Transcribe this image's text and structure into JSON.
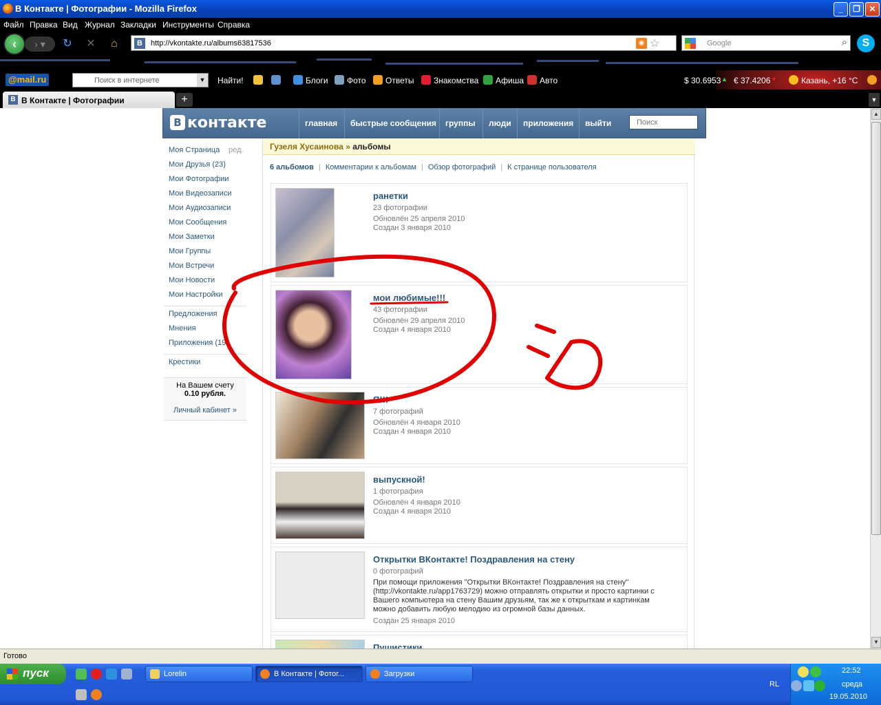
{
  "window": {
    "title": "В Контакте | Фотографии - Mozilla Firefox"
  },
  "menubar": [
    "Файл",
    "Правка",
    "Вид",
    "Журнал",
    "Закладки",
    "Инструменты",
    "Справка"
  ],
  "navbar": {
    "url": "http://vkontakte.ru/albums63817536",
    "search_placeholder": "Google"
  },
  "mailbar": {
    "logo": "@mail.ru",
    "search_placeholder": "Поиск в интернете",
    "find": "Найти!",
    "links": [
      "Блоги",
      "Фото",
      "Ответы",
      "Знакомства",
      "Афиша",
      "Авто"
    ],
    "usd": "$ 30.6953",
    "eur": "€ 37.4206",
    "weather": "Казань, +16 °C"
  },
  "tabs": [
    {
      "label": "В Контакте | Фотографии"
    }
  ],
  "vk": {
    "logo": "контакте",
    "logo_letter": "В",
    "nav": [
      "главная",
      "быстрые сообщения",
      "группы",
      "люди",
      "приложения",
      "выйти"
    ],
    "search_placeholder": "Поиск",
    "left_menu": [
      "Моя Страница",
      "Мои Друзья (23)",
      "Мои Фотографии",
      "Мои Видеозаписи",
      "Мои Аудиозаписи",
      "Мои Сообщения",
      "Мои Заметки",
      "Мои Группы",
      "Мои Встречи",
      "Мои Новости",
      "Мои Настройки",
      "Предложения",
      "Мнения",
      "Приложения (19",
      "Крестики"
    ],
    "edit_label": "ред.",
    "balance": {
      "line1": "На Вашем счету",
      "amount": "0.10 рубля.",
      "link": "Личный кабинет »"
    },
    "breadcrumb": {
      "user": "Гузеля Хусаинова",
      "sep": " » ",
      "page": "альбомы"
    },
    "subtabs": [
      "6 альбомов",
      "Комментарии к альбомам",
      "Обзор фотографий",
      "К странице пользователя"
    ],
    "albums": [
      {
        "name": "ранетки",
        "count": "23 фотографии",
        "updated": "Обновлён 25 апреля 2010",
        "created": "Создан 3 января 2010"
      },
      {
        "name": "мои любимые!!!",
        "count": "43 фотографии",
        "updated": "Обновлён 29 апреля 2010",
        "created": "Создан 4 января 2010"
      },
      {
        "name": "Я!!!",
        "count": "7 фотографий",
        "updated": "Обновлён 4 января 2010",
        "created": "Создан 4 января 2010"
      },
      {
        "name": "выпускной!",
        "count": "1 фотография",
        "updated": "Обновлён 4 января 2010",
        "created": "Создан 4 января 2010"
      },
      {
        "name": "Открытки ВКонтакте! Поздравления на стену",
        "count": "0 фотографий",
        "description": "При помощи приложения \"Открытки ВКонтакте! Поздравления на стену\" (http://vkontakte.ru/app1763729) можно отправлять открытки и просто картинки с Вашего компьютера на стену Вашим друзьям, так же к открыткам и картинкам можно добавить любую мелодию из огромной базы данных.",
        "created": "Создан 25 января 2010"
      },
      {
        "name": "Пушистики"
      }
    ]
  },
  "statusbar": {
    "text": "Готово"
  },
  "taskbar": {
    "start": "пуск",
    "tasks": [
      "Lorelin",
      "В Контакте | Фотог...",
      "Загрузки"
    ],
    "lang": "RL",
    "time": "22:52",
    "day": "среда",
    "date": "19.05.2010"
  }
}
